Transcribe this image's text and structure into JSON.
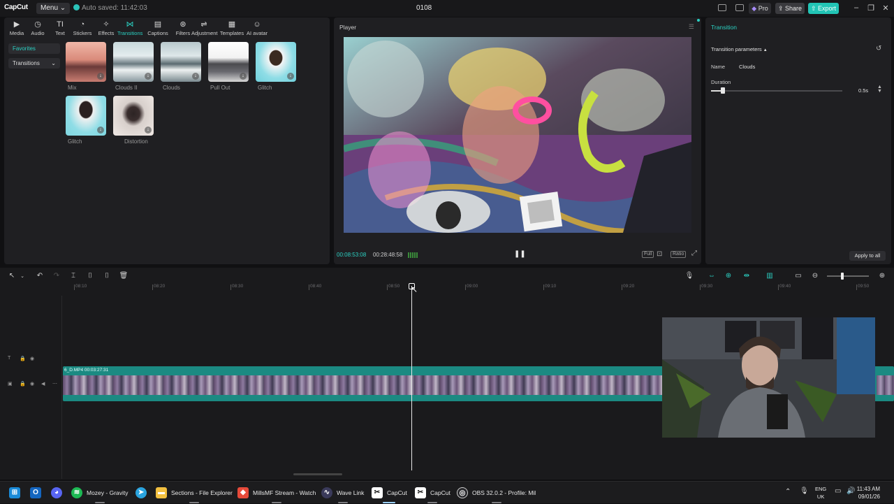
{
  "titlebar": {
    "logo": "CapCut",
    "menu": "Menu",
    "autosave": "Auto saved: 11:42:03",
    "project_title": "0108",
    "pro": "Pro",
    "share": "Share",
    "export": "Export"
  },
  "tabs": [
    {
      "label": "Media",
      "icon": "media-icon"
    },
    {
      "label": "Audio",
      "icon": "audio-icon"
    },
    {
      "label": "Text",
      "icon": "text-icon"
    },
    {
      "label": "Stickers",
      "icon": "stickers-icon"
    },
    {
      "label": "Effects",
      "icon": "effects-icon"
    },
    {
      "label": "Transitions",
      "icon": "transitions-icon"
    },
    {
      "label": "Captions",
      "icon": "captions-icon"
    },
    {
      "label": "Filters",
      "icon": "filters-icon"
    },
    {
      "label": "Adjustment",
      "icon": "adjustment-icon"
    },
    {
      "label": "Templates",
      "icon": "templates-icon"
    },
    {
      "label": "AI avatar",
      "icon": "ai-avatar-icon"
    }
  ],
  "sidebar": {
    "favorites": "Favorites",
    "transitions": "Transitions"
  },
  "transitions": [
    {
      "label": "Mix"
    },
    {
      "label": "Clouds II"
    },
    {
      "label": "Clouds"
    },
    {
      "label": "Pull Out"
    },
    {
      "label": "Glitch"
    },
    {
      "label": "Glitch"
    },
    {
      "label": "Distortion"
    }
  ],
  "player": {
    "title": "Player",
    "current_time": "00:08:53:08",
    "total_time": "00:28:48:58",
    "full_label": "Full",
    "ratio_label": "Ratio"
  },
  "properties": {
    "title": "Transition",
    "params_header": "Transition parameters",
    "name_label": "Name",
    "name_value": "Clouds",
    "duration_label": "Duration",
    "duration_value": "0.5s",
    "duration_fraction": 0.09,
    "apply_all": "Apply to all"
  },
  "timeline": {
    "ruler": [
      "08:10",
      "08:20",
      "08:30",
      "08:40",
      "08:50",
      "09:00",
      "09:10",
      "09:20",
      "09:30",
      "09:40",
      "09:50"
    ],
    "clip_label": "6_D.MP4   00:03:27:31"
  },
  "taskbar": {
    "items": [
      {
        "label": "Mozey - Gravity"
      },
      {
        "label": "Sections - File Explorer"
      },
      {
        "label": "MillsMF Stream - Watch"
      },
      {
        "label": "Wave Link"
      },
      {
        "label": "CapCut"
      },
      {
        "label": "CapCut"
      },
      {
        "label": "OBS 32.0.2 - Profile: Mil"
      }
    ],
    "lang_top": "ENG",
    "lang_bottom": "UK",
    "time": "11:43 AM",
    "date": "09/01/26"
  }
}
